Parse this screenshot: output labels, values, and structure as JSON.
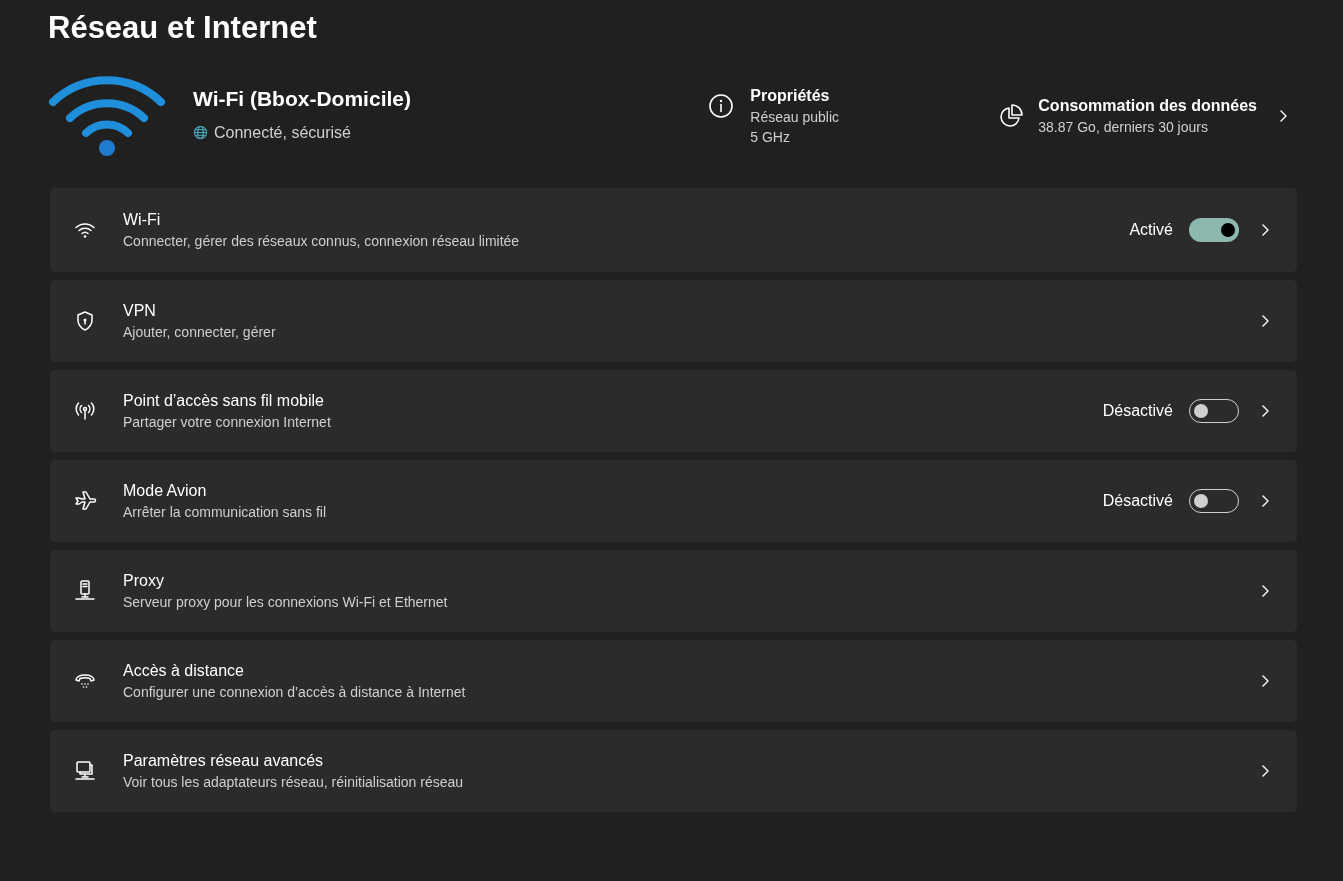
{
  "title": "Réseau et Internet",
  "connection": {
    "name": "Wi-Fi (Bbox-Domicile)",
    "status": "Connecté, sécurisé"
  },
  "properties": {
    "title": "Propriétés",
    "lines": [
      "Réseau public",
      "5 GHz"
    ]
  },
  "data_usage": {
    "title": "Consommation des données",
    "detail": "38.87 Go, derniers 30 jours"
  },
  "rows": [
    {
      "kind": "toggle",
      "title": "Wi-Fi",
      "subtitle": "Connecter, gérer des réseaux connus, connexion réseau limitée",
      "state_label": "Activé",
      "on": true
    },
    {
      "kind": "link",
      "title": "VPN",
      "subtitle": "Ajouter, connecter, gérer"
    },
    {
      "kind": "toggle",
      "title": "Point d’accès sans fil mobile",
      "subtitle": "Partager votre connexion Internet",
      "state_label": "Désactivé",
      "on": false
    },
    {
      "kind": "toggle",
      "title": "Mode Avion",
      "subtitle": "Arrêter la communication sans fil",
      "state_label": "Désactivé",
      "on": false
    },
    {
      "kind": "link",
      "title": "Proxy",
      "subtitle": "Serveur proxy pour les connexions Wi-Fi et Ethernet"
    },
    {
      "kind": "link",
      "title": "Accès à distance",
      "subtitle": "Configurer une connexion d’accès à distance à Internet"
    },
    {
      "kind": "link",
      "title": "Paramètres réseau avancés",
      "subtitle": "Voir tous les adaptateurs réseau, réinitialisation réseau"
    }
  ]
}
